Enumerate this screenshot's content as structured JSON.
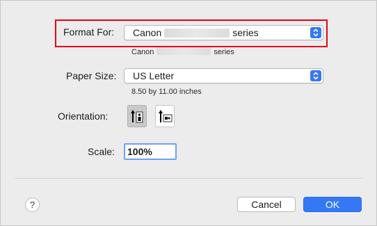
{
  "format_for": {
    "label": "Format For:",
    "value_prefix": "Canon",
    "value_suffix": "series",
    "sub_prefix": "Canon",
    "sub_suffix": "series"
  },
  "paper_size": {
    "label": "Paper Size:",
    "value": "US Letter",
    "dimensions": "8.50 by 11.00 inches"
  },
  "orientation": {
    "label": "Orientation:",
    "options": [
      {
        "name": "portrait",
        "selected": true
      },
      {
        "name": "landscape",
        "selected": false
      }
    ]
  },
  "scale": {
    "label": "Scale:",
    "value": "100%"
  },
  "footer": {
    "help_label": "?",
    "cancel_label": "Cancel",
    "ok_label": "OK"
  },
  "colors": {
    "accent": "#3478f6",
    "highlight_border": "#e3001b",
    "background": "#ececec"
  },
  "icons": [
    "chevron-updown-icon",
    "portrait-orientation-icon",
    "landscape-orientation-icon",
    "help-icon"
  ]
}
